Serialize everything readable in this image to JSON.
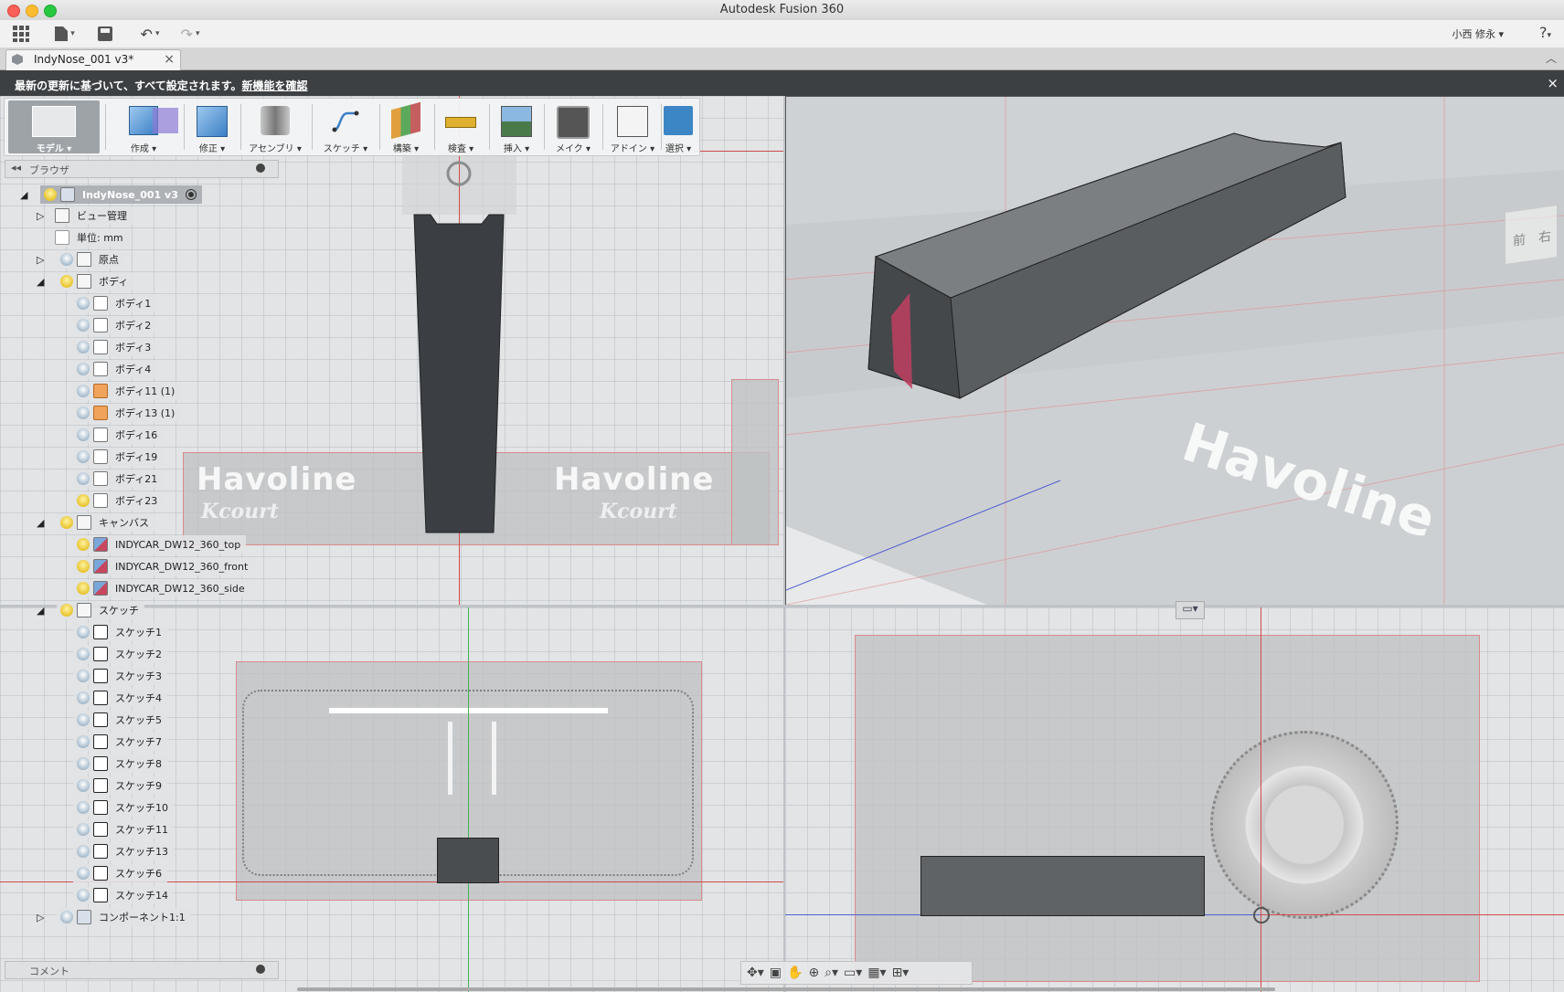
{
  "window": {
    "title": "Autodesk Fusion 360"
  },
  "quickbar": {
    "user": "小西 修永 ▾",
    "help": "?"
  },
  "tab": {
    "label": "IndyNose_001 v3*",
    "close": "×"
  },
  "notice": {
    "text": "最新の更新に基づいて、すべて設定されます。",
    "link": "新機能を確認",
    "close": "×"
  },
  "toolbar": [
    {
      "id": "model",
      "label": "モデル ▾"
    },
    {
      "id": "create",
      "label": "作成 ▾"
    },
    {
      "id": "modify",
      "label": "修正 ▾"
    },
    {
      "id": "assemble",
      "label": "アセンブリ ▾"
    },
    {
      "id": "sketch",
      "label": "スケッチ ▾"
    },
    {
      "id": "construct",
      "label": "構築 ▾"
    },
    {
      "id": "inspect",
      "label": "検査 ▾"
    },
    {
      "id": "insert",
      "label": "挿入 ▾"
    },
    {
      "id": "make",
      "label": "メイク ▾"
    },
    {
      "id": "addins",
      "label": "アドイン ▾"
    },
    {
      "id": "select",
      "label": "選択 ▾"
    }
  ],
  "browser": {
    "title": "ブラウザ",
    "root": "IndyNose_001 v3",
    "view_mgmt": "ビュー管理",
    "units": "単位: mm",
    "origin": "原点",
    "bodies_folder": "ボディ",
    "bodies": [
      "ボディ1",
      "ボディ2",
      "ボディ3",
      "ボディ4",
      "ボディ11 (1)",
      "ボディ13 (1)",
      "ボディ16",
      "ボディ19",
      "ボディ21",
      "ボディ23"
    ],
    "canvas_folder": "キャンバス",
    "canvases": [
      "INDYCAR_DW12_360_top",
      "INDYCAR_DW12_360_front",
      "INDYCAR_DW12_360_side"
    ],
    "sketch_folder": "スケッチ",
    "sketches": [
      "スケッチ1",
      "スケッチ2",
      "スケッチ3",
      "スケッチ4",
      "スケッチ5",
      "スケッチ7",
      "スケッチ8",
      "スケッチ9",
      "スケッチ10",
      "スケッチ11",
      "スケッチ13",
      "スケッチ6",
      "スケッチ14"
    ],
    "component": "コンポーネント1:1"
  },
  "comment": {
    "title": "コメント"
  },
  "viewcube": {
    "front": "前",
    "right": "右"
  },
  "viewport_labels": {
    "havoline": "Havoline",
    "kcourt": "Kcourt"
  },
  "icons": [
    "apps-grid-icon",
    "file-icon",
    "save-icon",
    "undo-icon",
    "redo-icon",
    "help-icon",
    "close-icon",
    "lightbulb-icon",
    "folder-icon",
    "body-icon",
    "sketch-icon",
    "canvas-icon",
    "orbit-icon",
    "pan-icon",
    "zoom-icon",
    "display-icon",
    "grid-icon",
    "viewports-icon"
  ]
}
